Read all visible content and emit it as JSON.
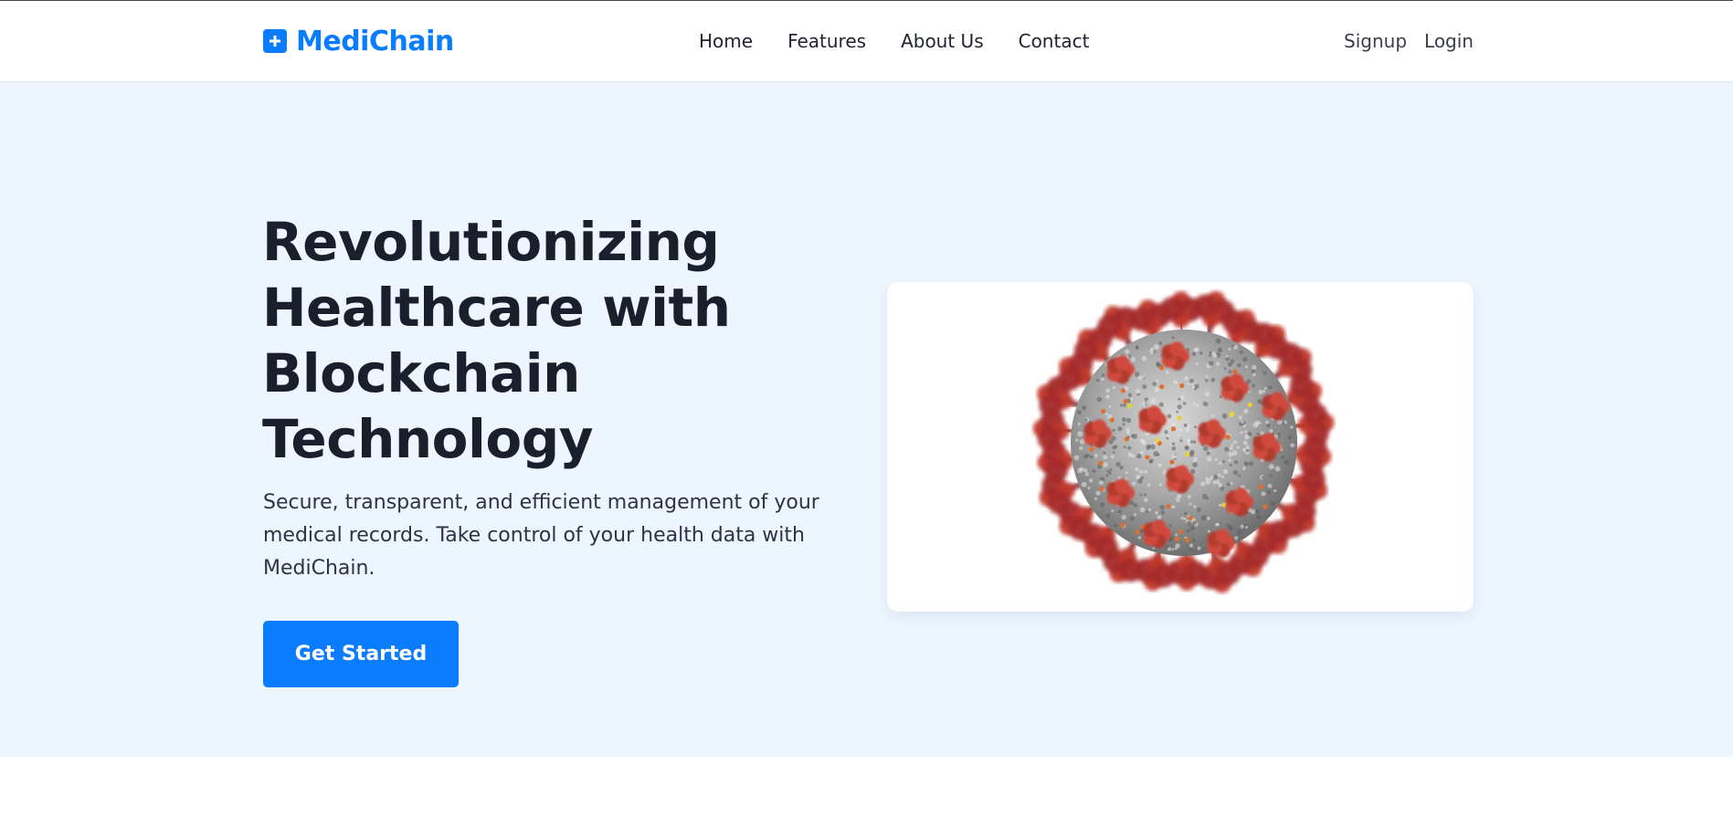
{
  "brand": {
    "name": "MediChain",
    "color": "#0a7cff",
    "icon": "plus-square-icon"
  },
  "nav": {
    "links": [
      "Home",
      "Features",
      "About Us",
      "Contact"
    ],
    "auth": {
      "signup": "Signup",
      "login": "Login"
    }
  },
  "hero": {
    "title": "Revolutionizing Healthcare with Blockchain Technology",
    "subtitle": "Secure, transparent, and efficient management of your medical records. Take control of your health data with MediChain.",
    "cta_label": "Get Started",
    "image": "virus-illustration",
    "background": "#edf5fe"
  }
}
